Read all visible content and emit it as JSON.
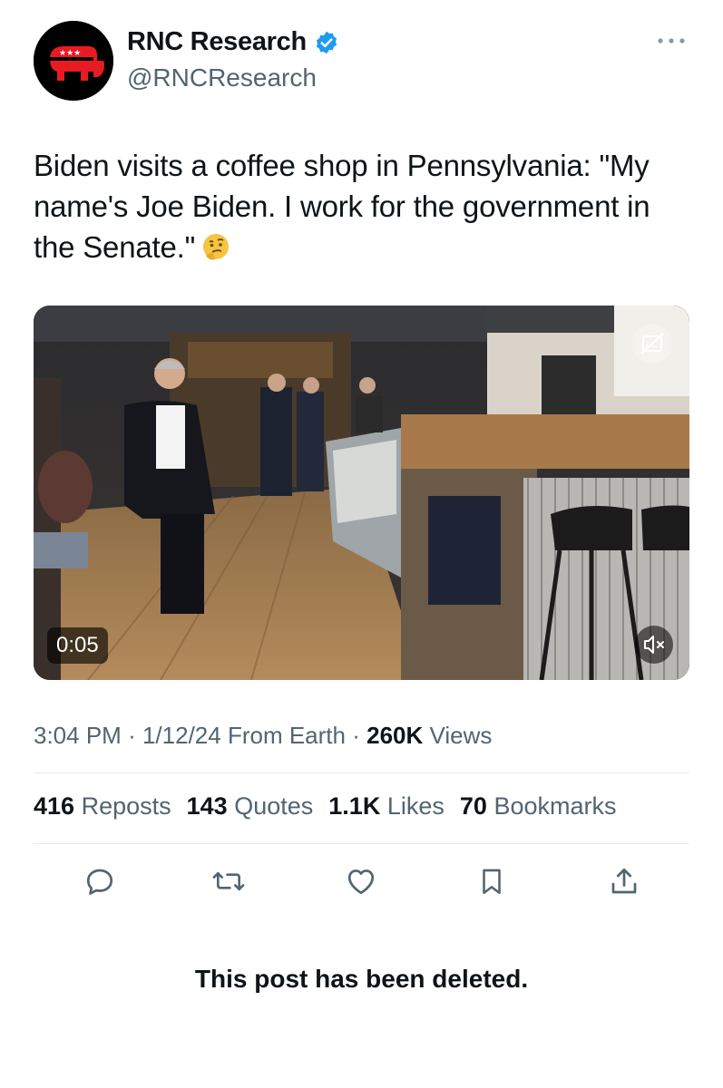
{
  "author": {
    "name": "RNC Research",
    "handle": "@RNCResearch",
    "verified": true,
    "avatar_icon": "gop-elephant-logo"
  },
  "tweet": {
    "text": "Biden visits a coffee shop in Pennsylvania: \"My name's Joe Biden. I work for the government in the Senate.\"",
    "emoji": "thinking-face"
  },
  "video": {
    "duration": "0:05",
    "controls": [
      "closed-captions-icon",
      "mute-icon"
    ]
  },
  "meta": {
    "time": "3:04 PM",
    "date": "1/12/24",
    "source": "From Earth",
    "views_count": "260K",
    "views_label": "Views"
  },
  "stats": {
    "reposts_count": "416",
    "reposts_label": "Reposts",
    "quotes_count": "143",
    "quotes_label": "Quotes",
    "likes_count": "1.1K",
    "likes_label": "Likes",
    "bookmarks_count": "70",
    "bookmarks_label": "Bookmarks"
  },
  "actions": [
    "reply-icon",
    "repost-icon",
    "like-icon",
    "bookmark-icon",
    "share-icon"
  ],
  "notice": "This post has been deleted.",
  "colors": {
    "verified": "#1d9bf0",
    "secondary_text": "#536471",
    "gop_red": "#e81b23"
  }
}
